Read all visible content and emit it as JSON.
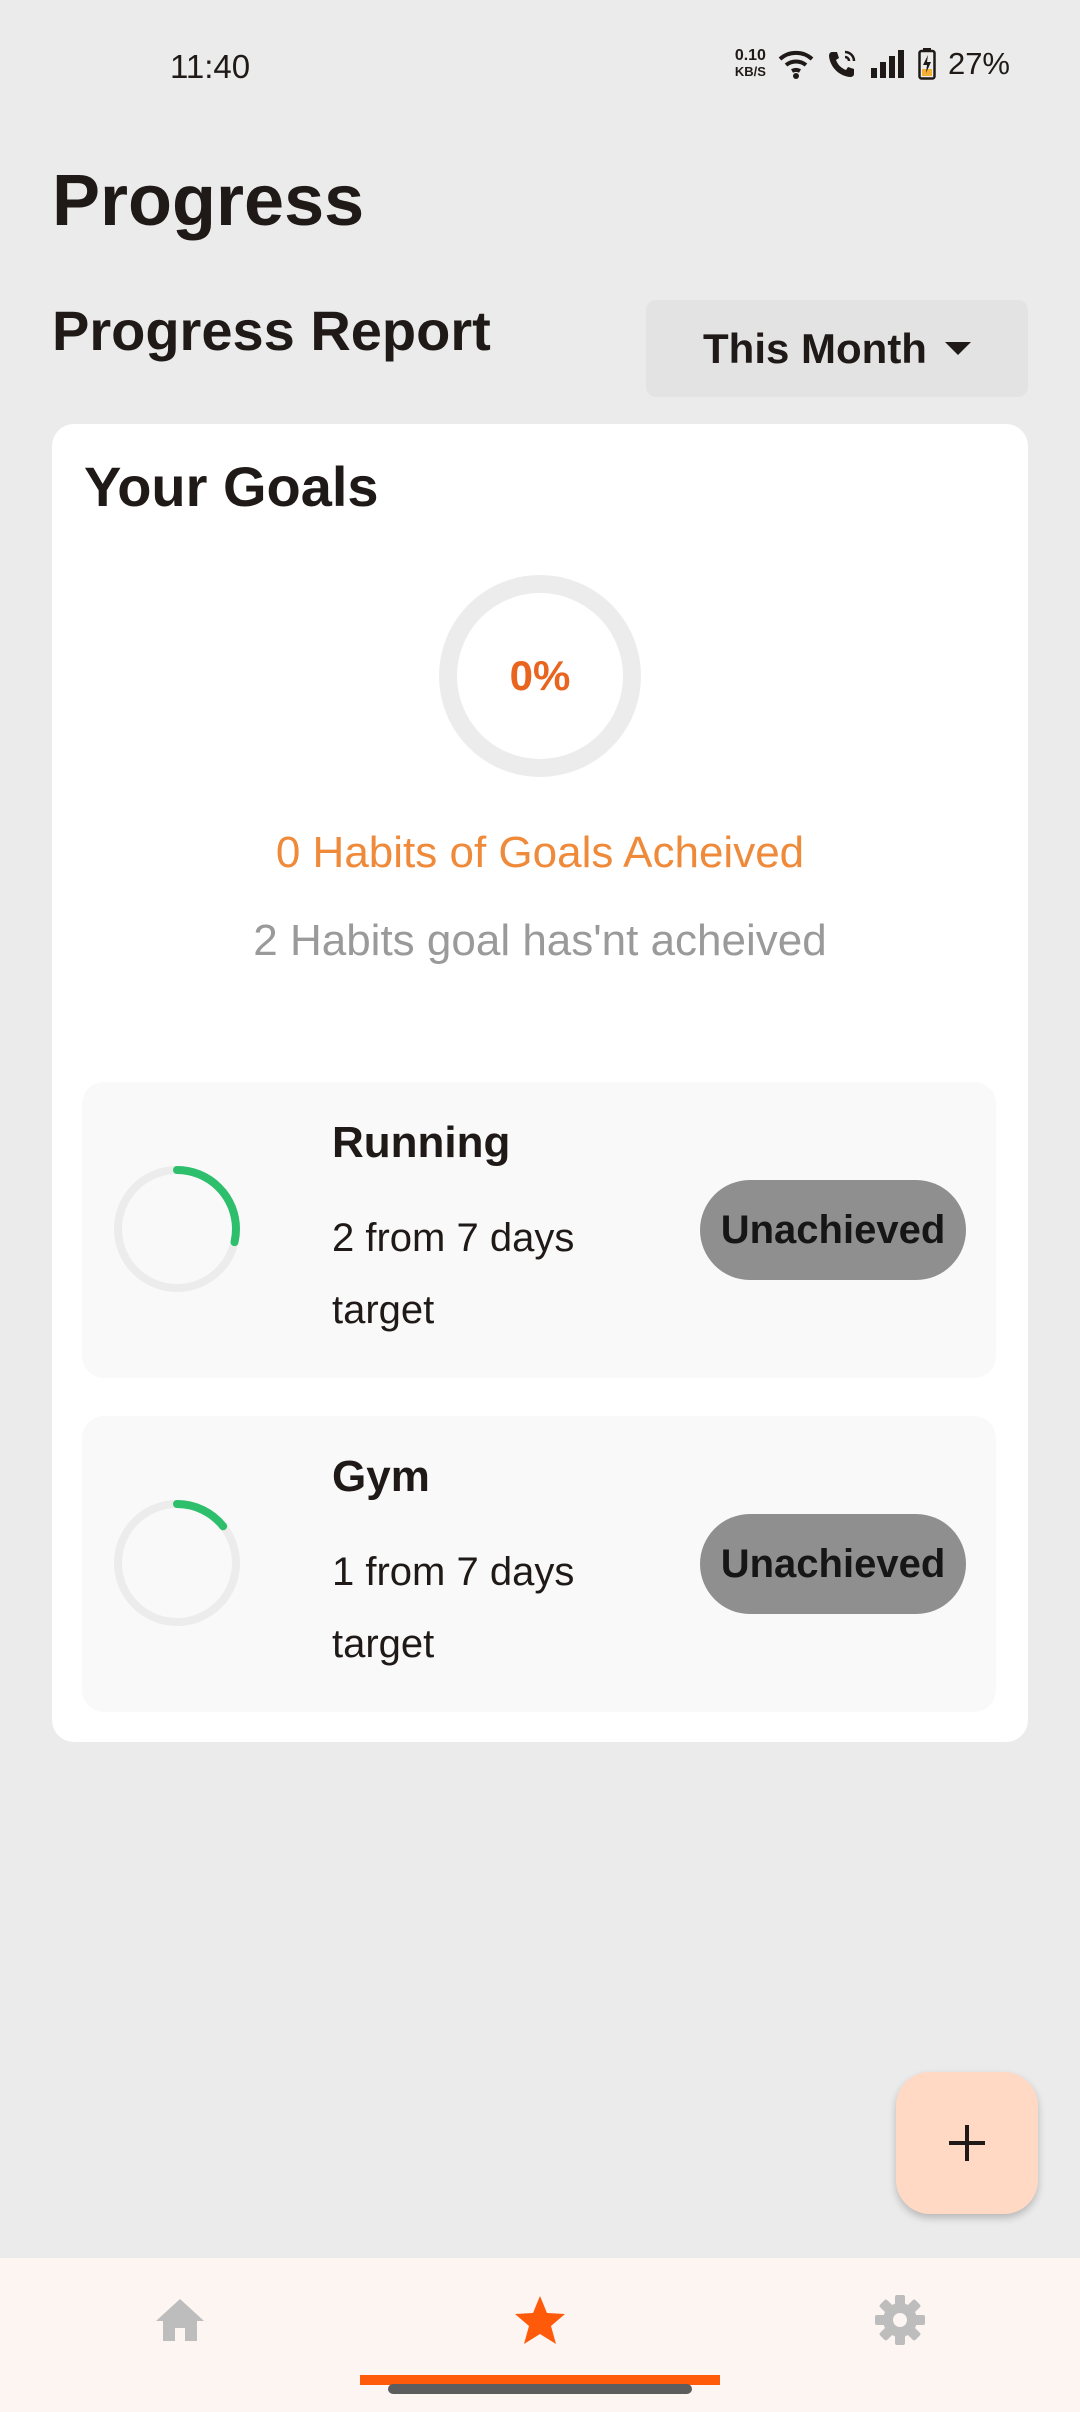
{
  "status_bar": {
    "time": "11:40",
    "net_speed_value": "0.10",
    "net_speed_unit": "KB/S",
    "battery": "27%"
  },
  "page": {
    "title": "Progress",
    "section_title": "Progress Report",
    "period_selected": "This Month"
  },
  "goals_card": {
    "title": "Your Goals",
    "overall_percent_label": "0%",
    "overall_fraction": 0,
    "achieved_text": "0 Habits of Goals Acheived",
    "unachieved_text": "2 Habits goal has'nt acheived"
  },
  "habits": [
    {
      "name": "Running",
      "target_text": "2 from 7 days target",
      "done": 2,
      "total": 7,
      "status": "Unachieved"
    },
    {
      "name": "Gym",
      "target_text": "1 from 7 days target",
      "done": 1,
      "total": 7,
      "status": "Unachieved"
    }
  ],
  "colors": {
    "accent": "#ff5a0a",
    "progress_green": "#2dbf6c",
    "ring_track": "#ececec",
    "badge": "#8f8f8f",
    "fab": "#ffd9c4"
  },
  "icons": {
    "fab": "plus-icon",
    "nav_home": "home-icon",
    "nav_progress": "star-icon",
    "nav_settings": "gear-icon"
  }
}
